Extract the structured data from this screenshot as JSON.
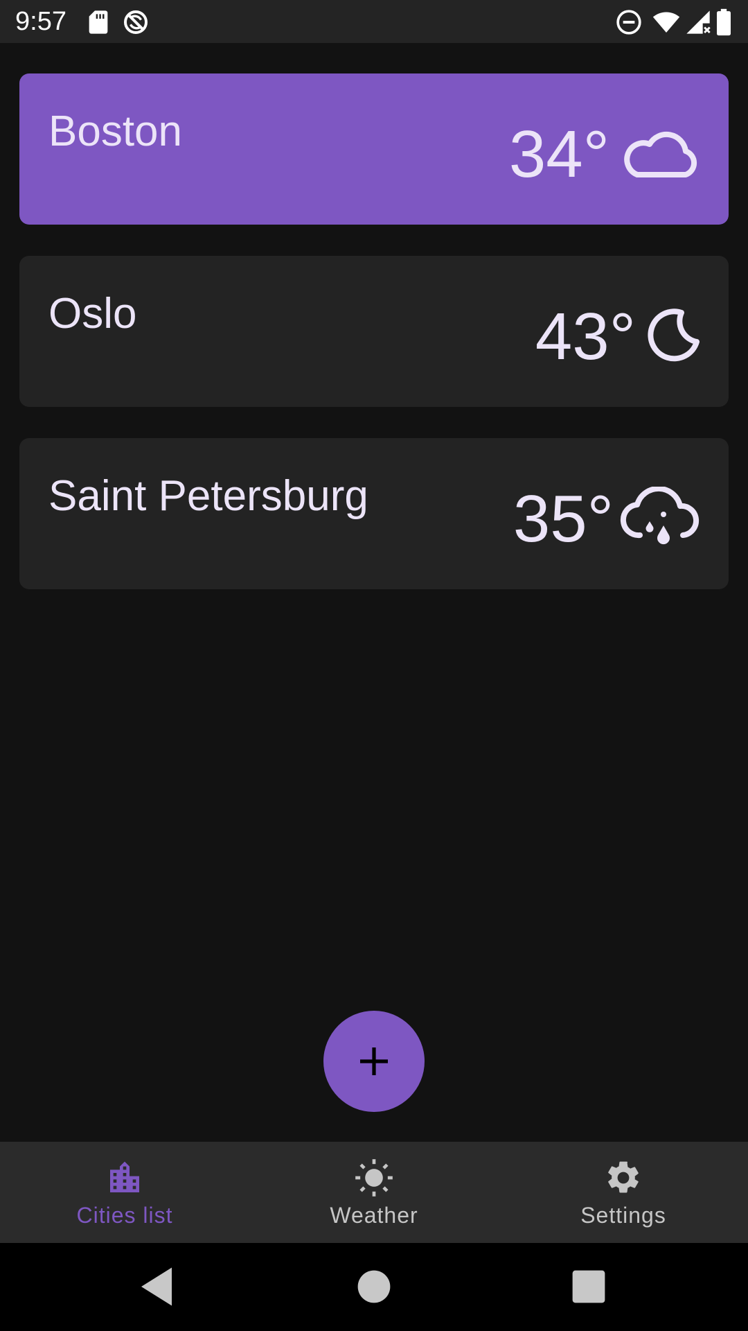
{
  "status_bar": {
    "time": "9:57",
    "left_icons": [
      "sd-card-icon",
      "sync-disabled-icon"
    ],
    "right_icons": [
      "do-not-disturb-icon",
      "wifi-icon",
      "signal-no-data-icon",
      "battery-icon"
    ]
  },
  "cities": [
    {
      "name": "Boston",
      "temperature": "34°",
      "icon": "cloud-icon",
      "selected": true
    },
    {
      "name": "Oslo",
      "temperature": "43°",
      "icon": "moon-icon",
      "selected": false
    },
    {
      "name": "Saint Petersburg",
      "temperature": "35°",
      "icon": "cloud-rain-icon",
      "selected": false
    }
  ],
  "fab": {
    "icon": "plus-icon"
  },
  "bottom_nav": {
    "items": [
      {
        "label": "Cities list",
        "icon": "city-icon",
        "active": true
      },
      {
        "label": "Weather",
        "icon": "sun-icon",
        "active": false
      },
      {
        "label": "Settings",
        "icon": "gear-icon",
        "active": false
      }
    ]
  },
  "system_nav": {
    "buttons": [
      "back-icon",
      "home-icon",
      "recents-icon"
    ]
  },
  "colors": {
    "accent": "#7e57c2",
    "background": "#121212",
    "card": "#232323",
    "text_primary": "#ece4f8",
    "nav_inactive": "#c6c6c6"
  }
}
